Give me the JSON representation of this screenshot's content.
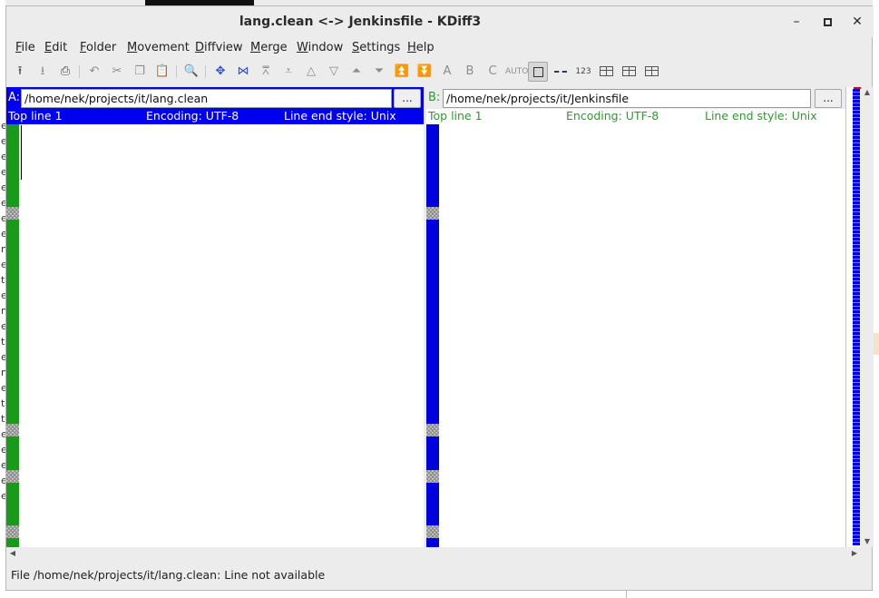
{
  "window": {
    "title": "lang.clean <-> Jenkinsfile - KDiff3",
    "minimize_glyph": "–",
    "close_glyph": "✕"
  },
  "menu": [
    {
      "label": "File",
      "ul": "F",
      "rest": "ile"
    },
    {
      "label": "Edit",
      "ul": "E",
      "rest": "dit"
    },
    {
      "label": "Folder",
      "ul": "F",
      "rest": "older"
    },
    {
      "label": "Movement",
      "ul": "M",
      "rest": "ovement"
    },
    {
      "label": "Diffview",
      "ul": "D",
      "rest": "iffview"
    },
    {
      "label": "Merge",
      "ul": "M",
      "rest": "erge"
    },
    {
      "label": "Window",
      "ul": "W",
      "rest": "indow"
    },
    {
      "label": "Settings",
      "ul": "S",
      "rest": "ettings"
    },
    {
      "label": "Help",
      "ul": "H",
      "rest": "elp"
    }
  ],
  "toolbar": {
    "show_line_numbers_label": "123",
    "auto_label": "AUTO",
    "letters": {
      "a": "A",
      "b": "B",
      "c": "C"
    }
  },
  "paneA": {
    "label": "A:",
    "path": "/home/nek/projects/it/lang.clean",
    "browse": "...",
    "top_line": "Top line 1",
    "encoding": "Encoding: UTF-8",
    "line_end": "Line end style: Unix",
    "color": "#0000ee",
    "diff_color": "#1a9a1a"
  },
  "paneB": {
    "label": "B:",
    "path": "/home/nek/projects/it/Jenkinsfile",
    "browse": "...",
    "top_line": "Top line 1",
    "encoding": "Encoding: UTF-8",
    "line_end": "Line end style: Unix",
    "color": "#2e9a2e",
    "diff_color": "#0000dd"
  },
  "status": {
    "text": "File /home/nek/projects/it/lang.clean: Line not available"
  },
  "background": {
    "left_letters": [
      "e",
      "e",
      "e",
      "e",
      "e",
      "e",
      "e",
      "e",
      "n",
      "e",
      "t",
      "e",
      "n",
      "e",
      "t",
      "e",
      "n",
      "e",
      "t",
      "t",
      "e",
      "e",
      "e",
      "e",
      "e"
    ]
  }
}
